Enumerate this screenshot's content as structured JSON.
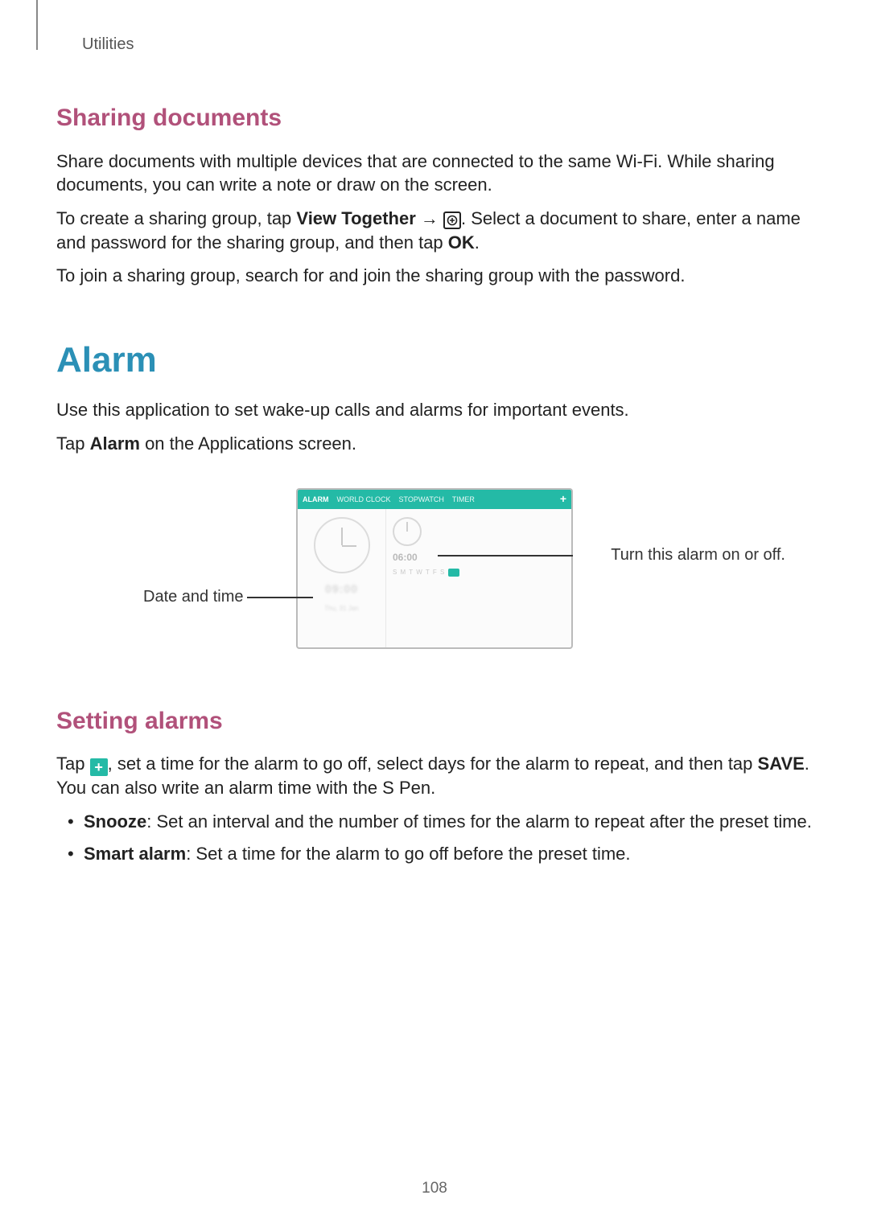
{
  "header": {
    "section": "Utilities"
  },
  "sharing": {
    "heading": "Sharing documents",
    "p1": "Share documents with multiple devices that are connected to the same Wi-Fi. While sharing documents, you can write a note or draw on the screen.",
    "p2a": "To create a sharing group, tap ",
    "p2_bold1": "View Together",
    "p2b": " → ",
    "p2c": ". Select a document to share, enter a name and password for the sharing group, and then tap ",
    "p2_bold2": "OK",
    "p2d": ".",
    "p3": "To join a sharing group, search for and join the sharing group with the password."
  },
  "alarm": {
    "heading": "Alarm",
    "p1": "Use this application to set wake-up calls and alarms for important events.",
    "p2a": "Tap ",
    "p2_bold": "Alarm",
    "p2b": " on the Applications screen."
  },
  "figure": {
    "left_label": "Date and time",
    "right_label": "Turn this alarm on or off.",
    "tabs": [
      "ALARM",
      "WORLD CLOCK",
      "STOPWATCH",
      "TIMER"
    ],
    "left_panel": {
      "time1": "09:00",
      "sub1": "Thu, 31 Jan"
    },
    "right_panel": {
      "time": "06:00",
      "days": "S M T W T F S"
    }
  },
  "setting": {
    "heading": "Setting alarms",
    "p1a": "Tap ",
    "p1b": ", set a time for the alarm to go off, select days for the alarm to repeat, and then tap ",
    "p1_bold": "SAVE",
    "p1c": ". You can also write an alarm time with the S Pen.",
    "items": [
      {
        "label": "Snooze",
        "text": ": Set an interval and the number of times for the alarm to repeat after the preset time."
      },
      {
        "label": "Smart alarm",
        "text": ": Set a time for the alarm to go off before the preset time."
      }
    ]
  },
  "page_number": "108"
}
